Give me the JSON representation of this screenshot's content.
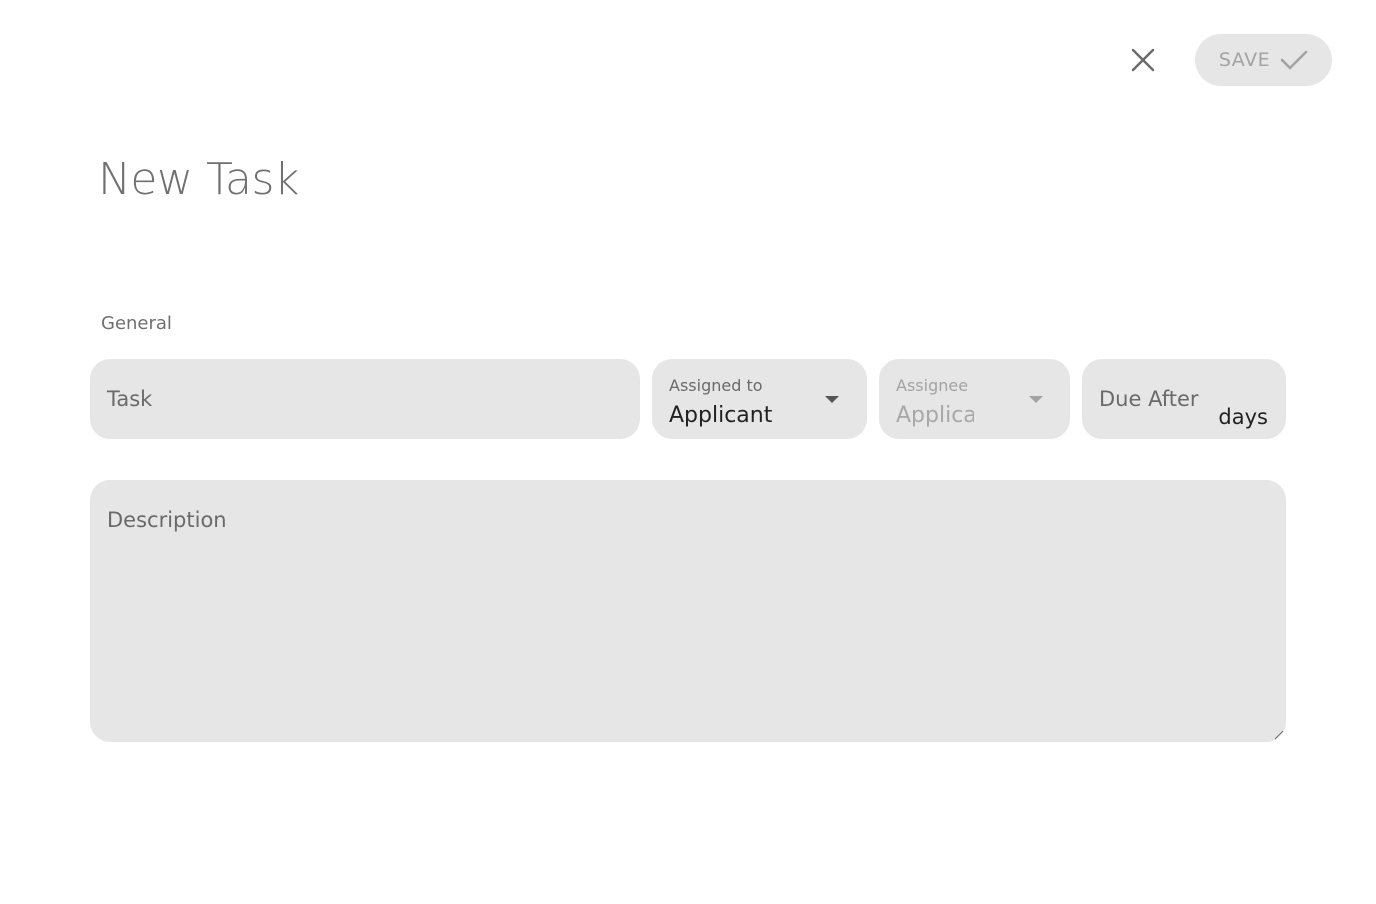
{
  "header": {
    "close_icon": "close-icon",
    "save_label": "SAVE",
    "save_icon": "check-icon"
  },
  "page": {
    "title": "New Task"
  },
  "general": {
    "section_label": "General",
    "task": {
      "placeholder": "Task",
      "value": ""
    },
    "assigned_to": {
      "label": "Assigned to",
      "value": "Applicant",
      "icon": "chevron-down-icon"
    },
    "assignee": {
      "label": "Assignee",
      "value": "Applicant",
      "icon": "chevron-down-icon"
    },
    "due_after": {
      "placeholder": "Due After",
      "suffix": "days"
    },
    "description": {
      "placeholder": "Description"
    }
  },
  "colors": {
    "field_background": "#e6e6e6",
    "save_text": "#a3a3a3",
    "title_text": "#707070"
  }
}
